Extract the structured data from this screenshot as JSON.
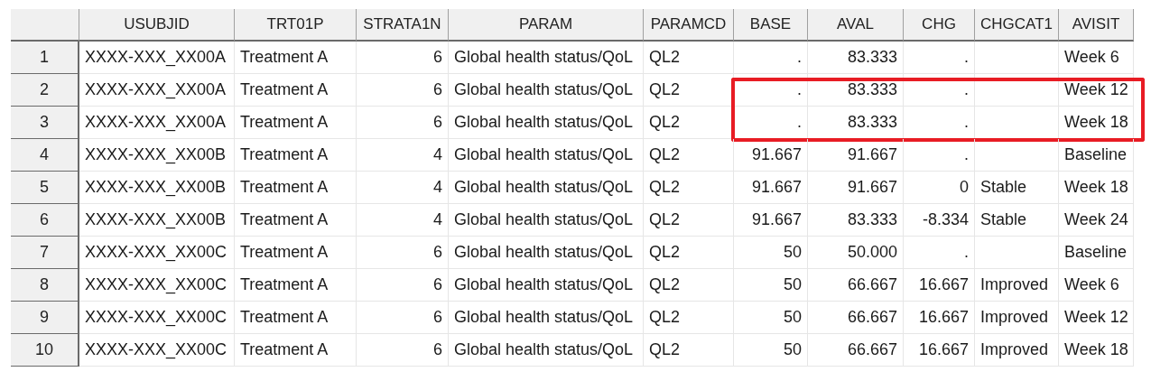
{
  "table": {
    "columns": [
      "USUBJID",
      "TRT01P",
      "STRATA1N",
      "PARAM",
      "PARAMCD",
      "BASE",
      "AVAL",
      "CHG",
      "CHGCAT1",
      "AVISIT"
    ],
    "rows": [
      {
        "number": "1",
        "highlighted": false,
        "cells": [
          "XXXX-XXX_XX00A",
          "Treatment A",
          "6",
          "Global health status/QoL",
          "QL2",
          ".",
          "83.333",
          ".",
          null,
          "Week 6"
        ]
      },
      {
        "number": "2",
        "highlighted": true,
        "cells": [
          "XXXX-XXX_XX00A",
          "Treatment A",
          "6",
          "Global health status/QoL",
          "QL2",
          ".",
          "83.333",
          ".",
          null,
          "Week 12"
        ]
      },
      {
        "number": "3",
        "highlighted": true,
        "cells": [
          "XXXX-XXX_XX00A",
          "Treatment A",
          "6",
          "Global health status/QoL",
          "QL2",
          ".",
          "83.333",
          ".",
          null,
          "Week 18"
        ]
      },
      {
        "number": "4",
        "highlighted": false,
        "cells": [
          "XXXX-XXX_XX00B",
          "Treatment A",
          "4",
          "Global health status/QoL",
          "QL2",
          "91.667",
          "91.667",
          ".",
          null,
          "Baseline"
        ]
      },
      {
        "number": "5",
        "highlighted": false,
        "cells": [
          "XXXX-XXX_XX00B",
          "Treatment A",
          "4",
          "Global health status/QoL",
          "QL2",
          "91.667",
          "91.667",
          "0",
          "Stable",
          "Week 18"
        ]
      },
      {
        "number": "6",
        "highlighted": false,
        "cells": [
          "XXXX-XXX_XX00B",
          "Treatment A",
          "4",
          "Global health status/QoL",
          "QL2",
          "91.667",
          "83.333",
          "-8.334",
          "Stable",
          "Week 24"
        ]
      },
      {
        "number": "7",
        "highlighted": false,
        "cells": [
          "XXXX-XXX_XX00C",
          "Treatment A",
          "6",
          "Global health status/QoL",
          "QL2",
          "50",
          "50.000",
          ".",
          null,
          "Baseline"
        ]
      },
      {
        "number": "8",
        "highlighted": false,
        "cells": [
          "XXXX-XXX_XX00C",
          "Treatment A",
          "6",
          "Global health status/QoL",
          "QL2",
          "50",
          "66.667",
          "16.667",
          "Improved",
          "Week 6"
        ]
      },
      {
        "number": "9",
        "highlighted": false,
        "cells": [
          "XXXX-XXX_XX00C",
          "Treatment A",
          "6",
          "Global health status/QoL",
          "QL2",
          "50",
          "66.667",
          "16.667",
          "Improved",
          "Week 12"
        ]
      },
      {
        "number": "10",
        "highlighted": false,
        "cells": [
          "XXXX-XXX_XX00C",
          "Treatment A",
          "6",
          "Global health status/QoL",
          "QL2",
          "50",
          "66.667",
          "16.667",
          "Improved",
          "Week 18"
        ]
      }
    ]
  }
}
